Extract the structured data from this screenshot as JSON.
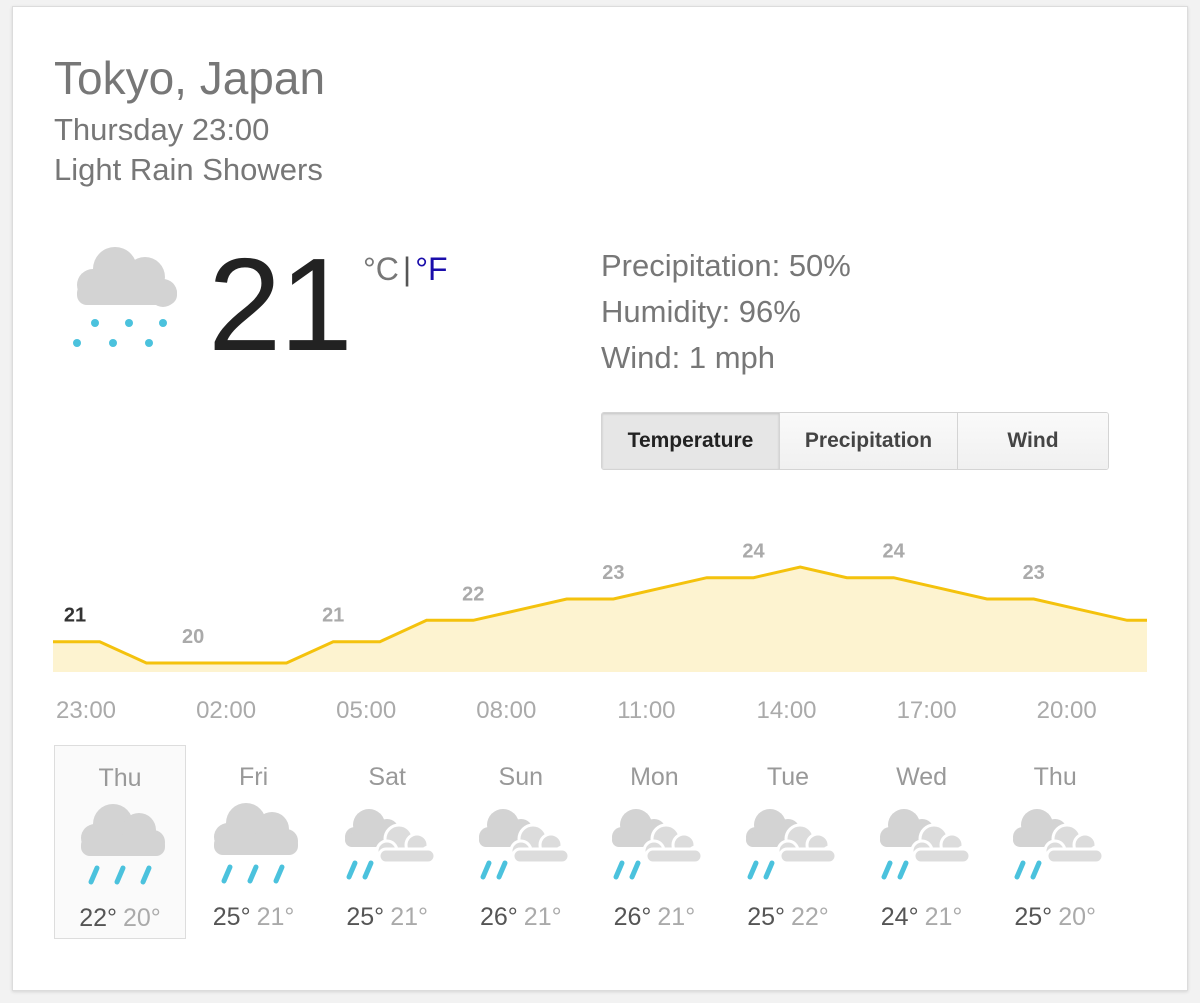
{
  "header": {
    "location": "Tokyo, Japan",
    "datetime": "Thursday 23:00",
    "condition": "Light Rain Showers"
  },
  "current": {
    "temperature": "21",
    "icon": "rain-cloud-icon",
    "unit_celsius": "°C",
    "unit_separator": "|",
    "unit_fahrenheit": "°F"
  },
  "details": {
    "precipitation": "Precipitation: 50%",
    "humidity": "Humidity: 96%",
    "wind": "Wind: 1 mph"
  },
  "tabs": [
    {
      "label": "Temperature",
      "active": true
    },
    {
      "label": "Precipitation",
      "active": false
    },
    {
      "label": "Wind",
      "active": false
    }
  ],
  "chart_data": {
    "type": "area",
    "x": [
      "23:00",
      "00:00",
      "01:00",
      "02:00",
      "03:00",
      "04:00",
      "05:00",
      "06:00",
      "07:00",
      "08:00",
      "09:00",
      "10:00",
      "11:00",
      "12:00",
      "13:00",
      "14:00",
      "15:00",
      "16:00",
      "17:00",
      "18:00",
      "19:00",
      "20:00",
      "21:00",
      "22:00"
    ],
    "values": [
      21,
      21,
      20,
      20,
      20,
      20,
      21,
      21,
      22,
      22,
      22.5,
      23,
      23,
      23.5,
      24,
      24,
      24.5,
      24,
      24,
      23.5,
      23,
      23,
      22.5,
      22
    ],
    "value_labels": [
      {
        "x": "23:00",
        "text": "21"
      },
      {
        "x": "02:00",
        "text": "20"
      },
      {
        "x": "05:00",
        "text": "21"
      },
      {
        "x": "08:00",
        "text": "22"
      },
      {
        "x": "11:00",
        "text": "23"
      },
      {
        "x": "14:00",
        "text": "24"
      },
      {
        "x": "17:00",
        "text": "24"
      },
      {
        "x": "20:00",
        "text": "23"
      }
    ],
    "tick_labels": [
      "23:00",
      "02:00",
      "05:00",
      "08:00",
      "11:00",
      "14:00",
      "17:00",
      "20:00"
    ],
    "line_color": "#f4c20d",
    "fill_color": "#fdf3d0",
    "grid": false
  },
  "forecast": [
    {
      "day": "Thu",
      "icon": "rain-icon",
      "hi": "22°",
      "lo": "20°",
      "selected": true
    },
    {
      "day": "Fri",
      "icon": "rain-icon",
      "hi": "25°",
      "lo": "21°",
      "selected": false
    },
    {
      "day": "Sat",
      "icon": "cloudy-showers-icon",
      "hi": "25°",
      "lo": "21°",
      "selected": false
    },
    {
      "day": "Sun",
      "icon": "cloudy-showers-icon",
      "hi": "26°",
      "lo": "21°",
      "selected": false
    },
    {
      "day": "Mon",
      "icon": "cloudy-showers-icon",
      "hi": "26°",
      "lo": "21°",
      "selected": false
    },
    {
      "day": "Tue",
      "icon": "cloudy-showers-icon",
      "hi": "25°",
      "lo": "22°",
      "selected": false
    },
    {
      "day": "Wed",
      "icon": "cloudy-showers-icon",
      "hi": "24°",
      "lo": "21°",
      "selected": false
    },
    {
      "day": "Thu",
      "icon": "cloudy-showers-icon",
      "hi": "25°",
      "lo": "20°",
      "selected": false
    }
  ],
  "colors": {
    "rain": "#4bc2dd",
    "cloud": "#d3d3d3",
    "link": "#1a0dab"
  }
}
